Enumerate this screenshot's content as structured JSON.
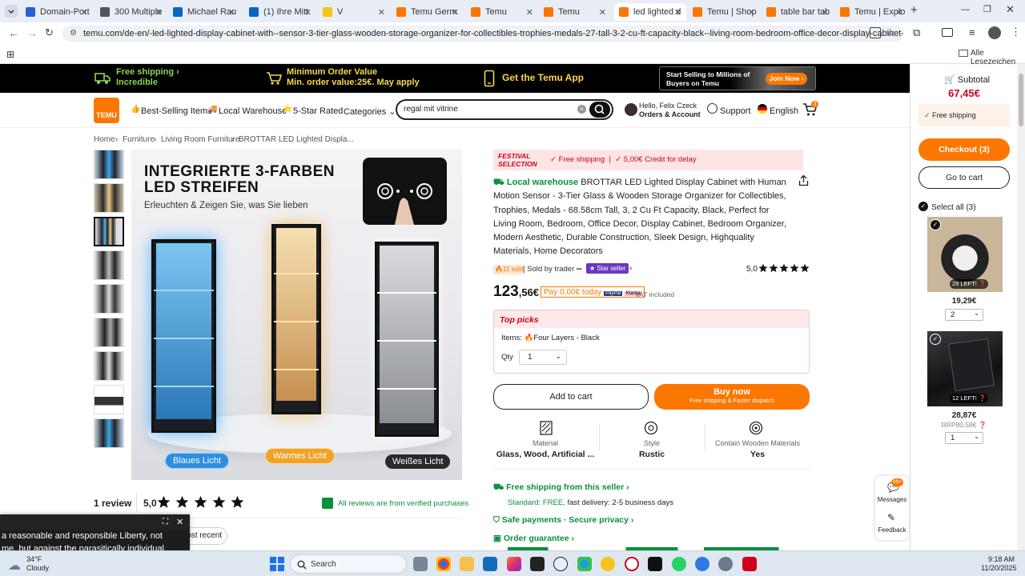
{
  "browser": {
    "tabs": [
      {
        "label": "Domain-Port",
        "icon": "uc-favicon",
        "color": "#2b5fd9"
      },
      {
        "label": "300 Multiple",
        "icon": "globe-favicon",
        "color": "#555555"
      },
      {
        "label": "Michael Rau",
        "icon": "linkedin-favicon",
        "color": "#0a66c2"
      },
      {
        "label": "(1) Ihre Mitt",
        "icon": "linkedin-favicon",
        "color": "#0a66c2"
      },
      {
        "label": "V",
        "icon": "emoji-favicon",
        "color": "#f5c518"
      },
      {
        "label": "Temu Germ",
        "icon": "temu-favicon",
        "color": "#fb7701"
      },
      {
        "label": "Temu",
        "icon": "temu-favicon",
        "color": "#fb7701"
      },
      {
        "label": "Temu",
        "icon": "temu-favicon",
        "color": "#fb7701"
      },
      {
        "label": "led lighted d",
        "icon": "temu-favicon",
        "color": "#fb7701"
      },
      {
        "label": "Temu | Shop",
        "icon": "temu-favicon",
        "color": "#fb7701"
      },
      {
        "label": "table bar tab",
        "icon": "temu-favicon",
        "color": "#fb7701"
      },
      {
        "label": "Temu | Explo",
        "icon": "temu-favicon",
        "color": "#fb7701"
      }
    ],
    "active_tab_index": 8,
    "url": "temu.com/de-en/-led-lighted-display-cabinet-with--sensor-3-tier-glass-wooden-storage-organizer-for-collectibles-trophies-medals-27-tall-3-2-cu-ft-capacity-black--living-room-bedroom-office-decor-display-cabinet-bedroom-organ...",
    "bookmarks_label": "Alle Lesezeichen"
  },
  "promo": {
    "shipping_title": "Free shipping",
    "shipping_sub": "Incredible",
    "min_title": "Minimum Order Value",
    "min_sub": "Min. order value:25€. May apply",
    "app": "Get the Temu App",
    "sell_line1": "Start Selling to Millions of",
    "sell_line2": "Buyers on Temu",
    "join": "Join Now"
  },
  "header": {
    "logo": "TEMU",
    "nav": [
      "Best-Selling Items",
      "Local Warehouse",
      "5-Star Rated",
      "Categories"
    ],
    "search_value": "regal mit vitrine",
    "account_hello": "Hello, Felix Czeck",
    "account_sub": "Orders & Account",
    "support": "Support",
    "language": "English",
    "cart_count": "3"
  },
  "breadcrumb": [
    "Home",
    "Furniture",
    "Living Room Furniture",
    "BROTTAR LED Lighted Displa..."
  ],
  "image": {
    "headline1": "INTEGRIERTE 3-FARBEN",
    "headline2": "LED STREIFEN",
    "subline": "Erleuchten & Zeigen Sie, was Sie lieben",
    "chip_blue": "Blaues Licht",
    "chip_warm": "Warmes Licht",
    "chip_white": "Weißes Licht"
  },
  "reviews": {
    "count_label": "1 review",
    "rating": "5,0",
    "verified": "All reviews are from verified purchases",
    "sort": "Most recent"
  },
  "product": {
    "festival": "FESTIVAL SELECTION",
    "free_shipping": "Free shipping",
    "credit": "5,00€ Credit for delay",
    "local_tag": "Local warehouse",
    "title": "BROTTAR LED Lighted Display Cabinet with Human Motion Sensor - 3-Tier Glass & Wooden Storage Organizer for Collectibles, Trophies, Medals - 68.58cm Tall, 3, 2 Cu Ft Capacity, Black, Perfect for Living Room, Bedroom, Office Decor, Display Cabinet, Bedroom Organizer, Modern Aesthetic, Durable Construction, Sleek Design, Highquality Materials, Home Decorators",
    "sold": "11 sold",
    "sold_by": "Sold by trader",
    "star_seller": "Star seller",
    "rating": "5,0",
    "price_main": "123",
    "price_cents": ",56€",
    "pay_today": "Pay 0,00€ today",
    "vat": "VAT included",
    "top_picks": "Top picks",
    "items_label": "Items:",
    "items_value": "Four Layers - Black",
    "qty_label": "Qty",
    "qty_value": "1",
    "add_to_cart": "Add to cart",
    "buy_now": "Buy now",
    "buy_now_sub": "Free shipping & Faster dispatch",
    "attr": [
      {
        "label": "Material",
        "value": "Glass, Wood, Artificial ..."
      },
      {
        "label": "Style",
        "value": "Rustic"
      },
      {
        "label": "Contain Wooden Materials",
        "value": "Yes"
      }
    ],
    "shipping_seller": "Free shipping from this seller",
    "standard": "Standard: FREE,",
    "fast": "fast delivery: 2-5 business days",
    "safe_pay": "Safe payments · Secure privacy",
    "guarantee": "Order guarantee"
  },
  "floating": {
    "messages": "Messages",
    "messages_badge": "99+",
    "feedback": "Feedback"
  },
  "cart": {
    "subtotal_label": "Subtotal",
    "subtotal": "67,45€",
    "free_shipping": "Free shipping",
    "checkout": "Checkout (3)",
    "go_to_cart": "Go to cart",
    "select_all": "Select all (3)",
    "items": [
      {
        "left": "29 LEFT!",
        "price": "19,29€",
        "rrp": "",
        "qty": "2"
      },
      {
        "left": "12 LEFT!",
        "price": "28,87€",
        "rrp": "RRP80,58€",
        "qty": "1"
      }
    ]
  },
  "toast": {
    "line1": "a reasonable and responsible Liberty, not",
    "line2": "me, but against the parasitically individual"
  },
  "taskbar": {
    "temp": "34°F",
    "weather": "Cloudy",
    "search": "Search",
    "time": "9:18 AM",
    "date": "11/20/2025"
  }
}
